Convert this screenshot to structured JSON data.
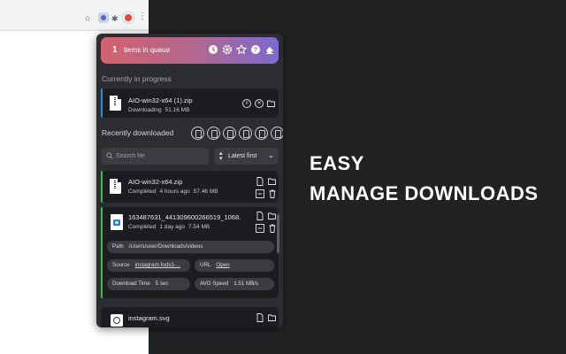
{
  "queue": {
    "count": "1",
    "label": "items in queue"
  },
  "sections": {
    "in_progress": "Currently in progress",
    "recent": "Recently downloaded"
  },
  "in_progress": {
    "name": "AIO-win32-x64 (1).zip",
    "status": "Downloading",
    "size": "51.16 MB"
  },
  "search": {
    "placeholder": "Search file"
  },
  "sort": {
    "label": "Latest first"
  },
  "downloads": [
    {
      "name": "AIO-win32-x64.zip",
      "status": "Completed",
      "time": "4 hours ago",
      "size": "57.46 MB"
    },
    {
      "name": "163487631_441309600266519_1068...",
      "status": "Completed",
      "time": "1 day ago",
      "size": "7.54 MB",
      "details": {
        "path_label": "Path",
        "path": "/Users/user/Downloads/videos",
        "source_label": "Source",
        "source": "instagram.fods3-...",
        "url_label": "URL",
        "url": "Open",
        "dtime_label": "Download Time",
        "dtime": "5 sec",
        "speed_label": "AVG Speed",
        "speed": "1.51 MB/s"
      }
    },
    {
      "name": "instagram.svg"
    }
  ],
  "hero": {
    "line1": "EASY",
    "line2": "MANAGE DOWNLOADS"
  },
  "colors": {
    "accent_blue": "#2b8dd6",
    "accent_green": "#3fbf4a",
    "queue_start": "#d4616d",
    "queue_end": "#7c6ad1"
  }
}
